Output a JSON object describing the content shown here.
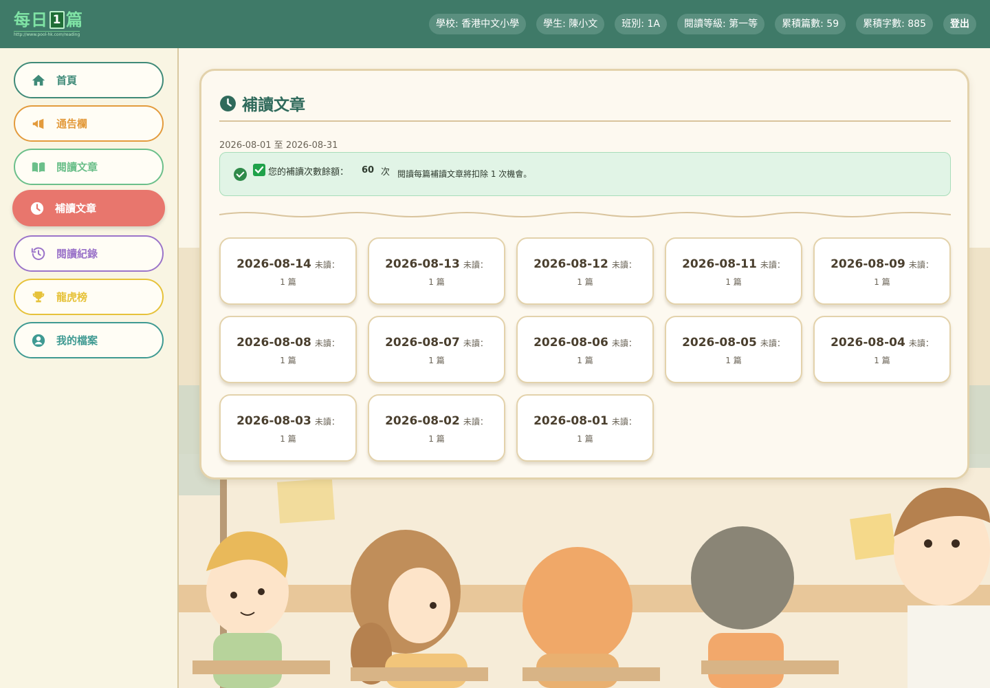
{
  "header": {
    "logo_pre": "每日",
    "logo_num": "1",
    "logo_post": "篇",
    "logo_url": "http://www.pool-hk.com/reading",
    "school": "學校: 香港中文小學",
    "student": "學生: 陳小文",
    "class": "班別: 1A",
    "level": "閱讀等級: 第一等",
    "articles": "累積篇數: 59",
    "words": "累積字數: 885",
    "logout": "登出"
  },
  "sidebar": {
    "items": [
      {
        "label": "首頁",
        "icon": "home-icon",
        "color": "#3f8a78"
      },
      {
        "label": "通告欄",
        "icon": "megaphone-icon",
        "color": "#e39b3d"
      },
      {
        "label": "閱讀文章",
        "icon": "book-icon",
        "color": "#6bbf8a"
      },
      {
        "label": "補讀文章",
        "icon": "clock-icon",
        "color": "#e8766d"
      },
      {
        "label": "閱讀紀錄",
        "icon": "history-icon",
        "color": "#9b74c9"
      },
      {
        "label": "龍虎榜",
        "icon": "trophy-icon",
        "color": "#e6c23a"
      },
      {
        "label": "我的檔案",
        "icon": "user-icon",
        "color": "#3f9a92"
      }
    ]
  },
  "main": {
    "title": "補讀文章",
    "range": "2026-08-01 至 2026-08-31",
    "notice": {
      "label": "您的補讀次數餘額：",
      "count": "60",
      "unit": "次",
      "note": "閱讀每篇補讀文章將扣除 1 次機會。"
    },
    "tiles": [
      {
        "date": "2026-08-14",
        "unread": "未讀：",
        "count": "1 篇"
      },
      {
        "date": "2026-08-13",
        "unread": "未讀：",
        "count": "1 篇"
      },
      {
        "date": "2026-08-12",
        "unread": "未讀：",
        "count": "1 篇"
      },
      {
        "date": "2026-08-11",
        "unread": "未讀：",
        "count": "1 篇"
      },
      {
        "date": "2026-08-09",
        "unread": "未讀：",
        "count": "1 篇"
      },
      {
        "date": "2026-08-08",
        "unread": "未讀：",
        "count": "1 篇"
      },
      {
        "date": "2026-08-07",
        "unread": "未讀：",
        "count": "1 篇"
      },
      {
        "date": "2026-08-06",
        "unread": "未讀：",
        "count": "1 篇"
      },
      {
        "date": "2026-08-05",
        "unread": "未讀：",
        "count": "1 篇"
      },
      {
        "date": "2026-08-04",
        "unread": "未讀：",
        "count": "1 篇"
      },
      {
        "date": "2026-08-03",
        "unread": "未讀：",
        "count": "1 篇"
      },
      {
        "date": "2026-08-02",
        "unread": "未讀：",
        "count": "1 篇"
      },
      {
        "date": "2026-08-01",
        "unread": "未讀：",
        "count": "1 篇"
      }
    ]
  },
  "colors": {
    "header_bg": "#3f7a68",
    "active_nav": "#e8766d",
    "card_border": "#e3d2ab",
    "notice_bg": "#e1f4e6"
  }
}
